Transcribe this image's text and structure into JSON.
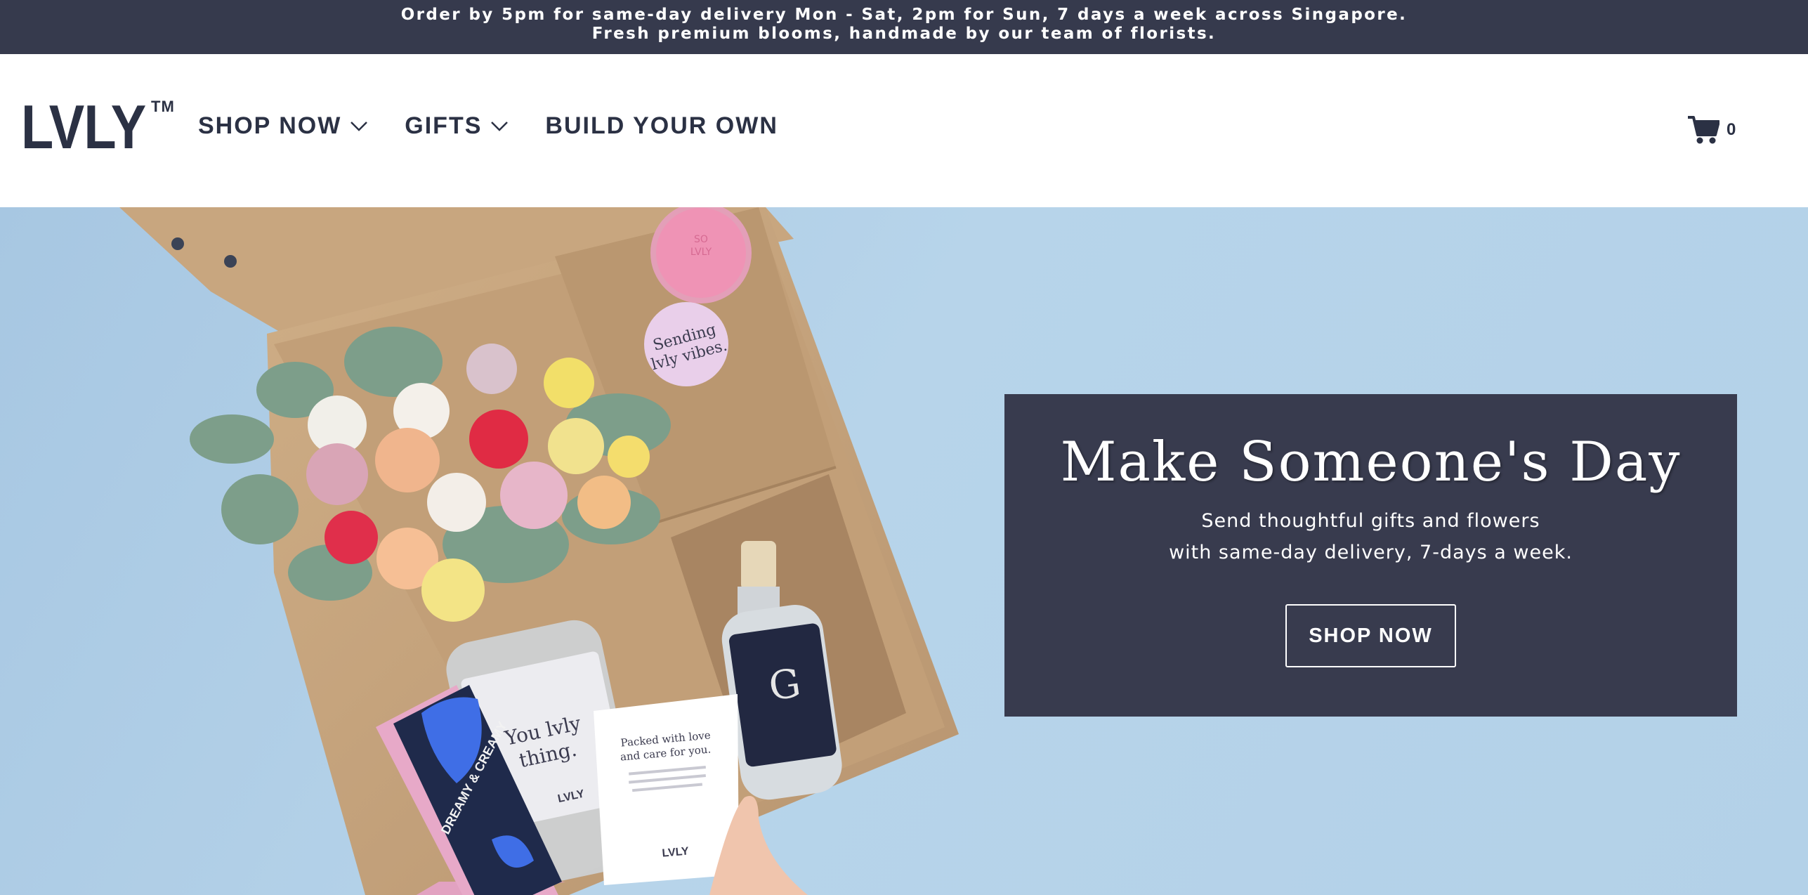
{
  "announcement": {
    "line1": "Order by 5pm for same-day delivery Mon - Sat, 2pm for Sun, 7 days a week across Singapore.",
    "line2": "Fresh premium blooms, handmade by our team of florists."
  },
  "header": {
    "logo_text": "LVLY",
    "logo_tm": "TM",
    "nav": [
      {
        "label": "SHOP NOW",
        "icon": "chevron-down-icon"
      },
      {
        "label": "GIFTS",
        "icon": "chevron-down-icon"
      },
      {
        "label": "BUILD YOUR OWN"
      }
    ],
    "cart": {
      "icon": "cart-icon",
      "count": "0"
    }
  },
  "hero": {
    "image_text": {
      "cookie": "SO LVLY",
      "sticker": "Sending lvly vibes.",
      "jar": "You lvly thing.",
      "jar_logo": "LVLY",
      "card_heading": "Packed with love and care for you.",
      "card_logo": "LVLY",
      "bottle_letter": "G",
      "chocolate": "DREAMY & CREAMY"
    },
    "promo": {
      "title": "Make Someone's Day",
      "subtitle_line1": "Send thoughtful gifts and flowers",
      "subtitle_line2": "with same-day delivery, 7-days a week.",
      "button": "SHOP NOW"
    }
  },
  "colors": {
    "announcement_bg": "#363a4d",
    "brand_text": "#2b3144",
    "hero_bg": "#b3d1e8",
    "promo_bg": "#383b4e"
  }
}
